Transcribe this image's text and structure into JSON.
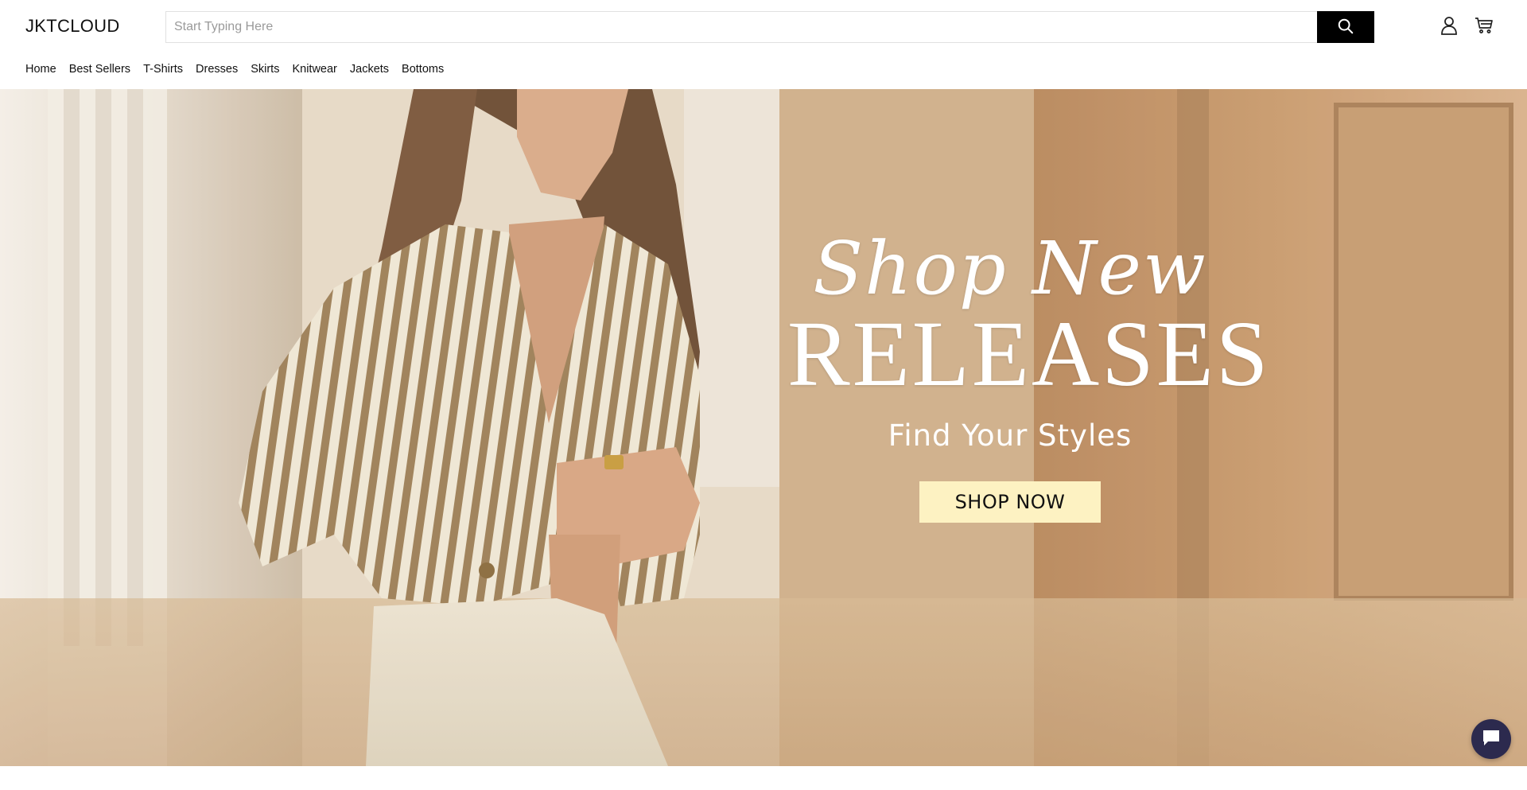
{
  "header": {
    "logo": "JKTCLOUD",
    "search": {
      "placeholder": "Start Typing Here",
      "value": ""
    },
    "icons": [
      "search-icon",
      "account-icon",
      "cart-icon"
    ]
  },
  "nav": {
    "items": [
      {
        "label": "Home"
      },
      {
        "label": "Best Sellers"
      },
      {
        "label": "T-Shirts"
      },
      {
        "label": "Dresses"
      },
      {
        "label": "Skirts"
      },
      {
        "label": "Knitwear"
      },
      {
        "label": "Jackets"
      },
      {
        "label": "Bottoms"
      }
    ]
  },
  "hero": {
    "script_title": "Shop New",
    "big_title": "RELEASES",
    "subtitle": "Find Your Styles",
    "cta_label": "SHOP NOW"
  },
  "colors": {
    "search_button": "#000000",
    "cta_background": "#fdf2c2",
    "chat_button": "#2c2a4e"
  },
  "chat": {
    "icon": "chat-icon"
  }
}
